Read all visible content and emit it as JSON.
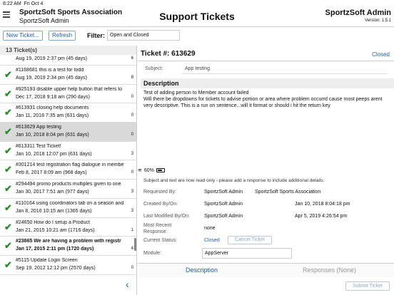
{
  "statusbar": {
    "time": "8:22 AM",
    "day": "Fri Oct 4",
    "battery": "60%"
  },
  "header": {
    "org": "SportzSoft Sports Association",
    "user": "SportzSoft Admin",
    "title": "Support Tickets",
    "brand": "SportzSoft Admin",
    "version": "Version: 1.5.1"
  },
  "toolbar": {
    "new_label": "New Ticket...",
    "refresh_label": "Refresh",
    "filter_label": "Filter:",
    "filter_value": "Open and Closed"
  },
  "list": {
    "count": "13 Ticket(s)",
    "rows": [
      {
        "subject": "",
        "date": "Aug 19, 2019 2:37 pm (45 days)",
        "count": "6",
        "partial": true
      },
      {
        "subject": "#1168681 this is a test for todd",
        "date": "Aug 19, 2019 2:34 pm (45 days)",
        "count": "8"
      },
      {
        "subject": "#925193   disable upper help button that refers to",
        "date": "Dec 17, 2018 9:18 am (290 days)",
        "count": "0"
      },
      {
        "subject": "#613931   closing help documents",
        "date": "Jan 11, 2018 7:35 am (631 days)",
        "count": "0"
      },
      {
        "subject": "#613629   App testing",
        "date": "Jan 10, 2018 8:04 pm (631 days)",
        "count": "0",
        "selected": true
      },
      {
        "subject": "#613311   Test Ticket!",
        "date": "Jan 10, 2018 12:07 pm (631 days)",
        "count": "3"
      },
      {
        "subject": "#301214   test registration flag dialogue in membe",
        "date": "Feb 8, 2017 8:09 am (968 days)",
        "count": "0"
      },
      {
        "subject": "#294494   promo products multiples given to one",
        "date": "Jan 30, 2017 7:51 am (977 days)",
        "count": "3"
      },
      {
        "subject": "#110164   using coordinators tab on a season  and",
        "date": "Jan 8, 2016 10:15 am (1365 days)",
        "count": "3"
      },
      {
        "subject": "#24650   How do I setup a Product",
        "date": "Jan 21, 2015 10:21 am (1716 days)",
        "count": "1"
      },
      {
        "subject": "#23865   We are having a problem with registr",
        "date": "Jan 17, 2015 2:11 pm (1720 days)",
        "count": "4",
        "bold": true
      },
      {
        "subject": "#5115     Update Login Screen",
        "date": "Sep 19, 2012 12:12 pm (2570 days)",
        "count": "0"
      }
    ]
  },
  "ticket": {
    "number": "Ticket #: 613629",
    "status_top": "Closed",
    "subject_label": "Subject:",
    "subject_value": "App testing",
    "description_title": "Description",
    "description": "Test of adding person to Member account failed\nWill there be dropdowns for tickets to advise portion or area where problem occurrd cause most peeps arent very descriptive. This is a run on sentence...will it format or should i hit the return key",
    "note": "Subject and text are now read only - please add a response to include additional details.",
    "requested_by_label": "Requested By:",
    "requested_by": "SportzSoft Admin",
    "requested_org": "SportzSoft Sports Association",
    "created_label": "Created By/On:",
    "created_by": "SportzSoft Admin",
    "created_on": "Jan 10, 2018 8:04:18 pm",
    "modified_label": "Last Modified By/On:",
    "modified_by": "SportzSoft Admin",
    "modified_on": "Apr 5, 2019 4:26:54 pm",
    "recent_label": "Most Recent Response:",
    "recent_value": "none",
    "status_label": "Current Status:",
    "status_value": "Closed",
    "cancel_label": "Cancel Ticket",
    "module_label": "Module:",
    "module_value": "AppServer",
    "tab_description": "Description",
    "tab_responses": "Responses (None)",
    "submit_label": "Submit Ticket"
  }
}
